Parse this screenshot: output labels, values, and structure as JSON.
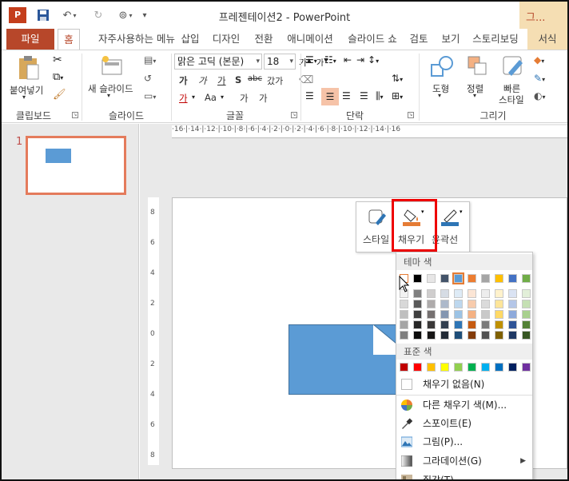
{
  "window": {
    "title": "프레젠테이션2 - PowerPoint",
    "contextual_tab": "그..."
  },
  "tabs": [
    "파일",
    "홈",
    "자주사용하는 메뉴",
    "삽입",
    "디자인",
    "전환",
    "애니메이션",
    "슬라이드 쇼",
    "검토",
    "보기",
    "스토리보딩",
    "서식"
  ],
  "ribbon": {
    "clipboard": {
      "paste": "붙여넣기",
      "label": "클립보드"
    },
    "slides": {
      "new_slide": "새 슬라이드",
      "label": "슬라이드"
    },
    "font": {
      "font_name": "맑은 고딕 (본문)",
      "font_size": "18",
      "label": "글꼴",
      "bold": "가",
      "italic": "가",
      "underline": "가",
      "shadow": "S",
      "strike": "abc",
      "spacing": "갔가",
      "color": "가",
      "case": "Aa",
      "grow": "가",
      "shrink": "가"
    },
    "paragraph": {
      "label": "단락"
    },
    "drawing": {
      "shapes": "도형",
      "arrange": "정렬",
      "quick_styles_1": "빠른",
      "quick_styles_2": "스타일",
      "label": "그리기"
    }
  },
  "ruler": {
    "h_ticks": "·16·|·14·|·12·|·10·|·8·|·6·|·4·|·2·|·0·|·2·|·4·|·6·|·8·|·10·|·12·|·14·|·16",
    "v_ticks": [
      "8",
      "6",
      "4",
      "2",
      "0",
      "2",
      "4",
      "6",
      "8"
    ]
  },
  "slides_pane": {
    "slide_number": "1"
  },
  "mini_toolbar": {
    "style": "스타일",
    "fill": "채우기",
    "outline": "윤곽선"
  },
  "fill_menu": {
    "theme_colors_header": "테마 색",
    "standard_colors_header": "표준 색",
    "no_fill": "채우기 없음(N)",
    "more_colors": "다른 채우기 색(M)...",
    "eyedropper": "스포이트(E)",
    "picture": "그림(P)...",
    "gradient": "그라데이션(G)",
    "texture": "질감(T)",
    "theme_top": [
      "#ffffff",
      "#000000",
      "#e7e6e6",
      "#44546a",
      "#5b9bd5",
      "#ed7d31",
      "#a5a5a5",
      "#ffc000",
      "#4472c4",
      "#70ad47"
    ],
    "theme_shades": [
      [
        "#f2f2f2",
        "#7f7f7f",
        "#d0cece",
        "#d6dce4",
        "#deebf6",
        "#fbe5d5",
        "#ededed",
        "#fff2cc",
        "#dae3f3",
        "#e2efd9"
      ],
      [
        "#d8d8d8",
        "#595959",
        "#aeabab",
        "#adb9ca",
        "#bdd7ee",
        "#f7cbac",
        "#dbdbdb",
        "#fee599",
        "#b4c6e7",
        "#c5e0b3"
      ],
      [
        "#bfbfbf",
        "#3f3f3f",
        "#757070",
        "#8496b0",
        "#9cc3e5",
        "#f4b183",
        "#c9c9c9",
        "#ffd965",
        "#8eaadb",
        "#a8d08d"
      ],
      [
        "#a5a5a5",
        "#262626",
        "#3a3838",
        "#323f4f",
        "#2e75b5",
        "#c55a11",
        "#7b7b7b",
        "#bf9000",
        "#2f5496",
        "#538135"
      ],
      [
        "#7f7f7f",
        "#0c0c0c",
        "#171616",
        "#222a35",
        "#1e4e79",
        "#833c0b",
        "#525252",
        "#7f6000",
        "#1f3864",
        "#375623"
      ]
    ],
    "standard": [
      "#c00000",
      "#ff0000",
      "#ffc000",
      "#ffff00",
      "#92d050",
      "#00b050",
      "#00b0f0",
      "#0070c0",
      "#002060",
      "#7030a0"
    ]
  }
}
